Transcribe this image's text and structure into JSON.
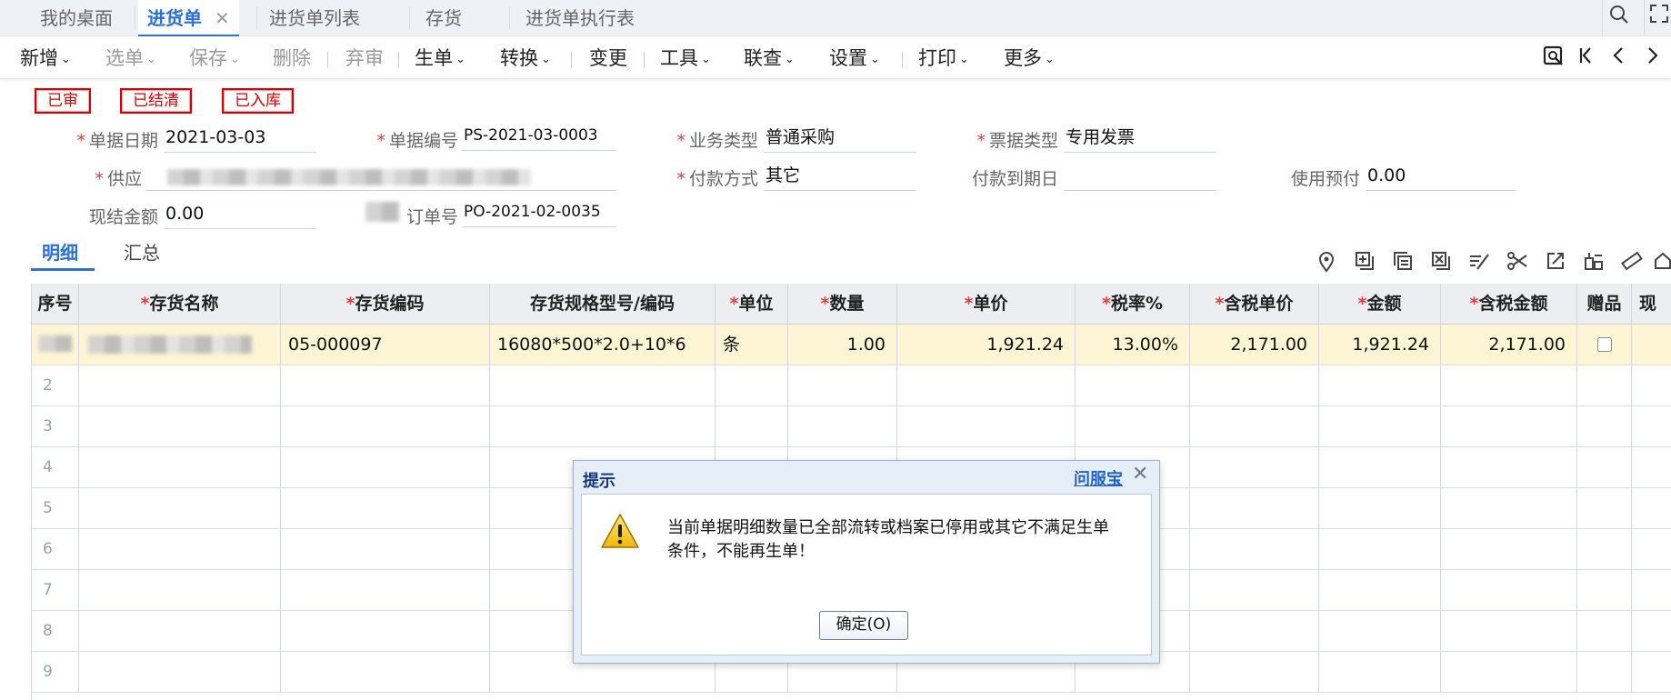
{
  "tabs": [
    {
      "label": "我的桌面"
    },
    {
      "label": "进货单",
      "close": "✕"
    },
    {
      "label": "进货单列表"
    },
    {
      "label": "存货"
    },
    {
      "label": "进货单执行表"
    }
  ],
  "toolbar": {
    "new": "新增",
    "select": "选单",
    "save": "保存",
    "delete": "删除",
    "unaudit": "弃审",
    "generate": "生单",
    "convert": "转换",
    "change": "变更",
    "tools": "工具",
    "query": "联查",
    "settings": "设置",
    "print": "打印",
    "more": "更多",
    "caret": "⌄"
  },
  "stamps": [
    "已审",
    "已结清",
    "已入库"
  ],
  "form": {
    "doc_date": {
      "label": "单据日期",
      "value": "2021-03-03"
    },
    "doc_no": {
      "label": "单据编号",
      "value": "PS-2021-03-0003"
    },
    "biz_type": {
      "label": "业务类型",
      "value": "普通采购"
    },
    "invoice_type": {
      "label": "票据类型",
      "value": "专用发票"
    },
    "supplier": {
      "label": "供应"
    },
    "pay_method": {
      "label": "付款方式",
      "value": "其它"
    },
    "pay_due": {
      "label": "付款到期日",
      "value": ""
    },
    "prepay": {
      "label": "使用预付",
      "value": "0.00"
    },
    "settle_amount": {
      "label": "现结金额",
      "value": "0.00"
    },
    "po_no": {
      "label": "订单号",
      "value": "PO-2021-02-0035"
    }
  },
  "subtabs": {
    "detail": "明细",
    "summary": "汇总"
  },
  "grid": {
    "headers": {
      "idx": "序号",
      "name": "存货名称",
      "code": "存货编码",
      "spec": "存货规格型号/编码",
      "unit": "单位",
      "qty": "数量",
      "price": "单价",
      "tax": "税率%",
      "tax_price": "含税单价",
      "amount": "金额",
      "tax_amount": "含税金额",
      "gift": "赠品",
      "extra": "现"
    },
    "req": "*",
    "row1": {
      "code": "05-000097",
      "spec": "16080*500*2.0+10*6",
      "unit": "条",
      "qty": "1.00",
      "price": "1,921.24",
      "tax": "13.00%",
      "tax_price": "2,171.00",
      "amount": "1,921.24",
      "tax_amount": "2,171.00"
    },
    "row_numbers": [
      "2",
      "3",
      "4",
      "5",
      "6",
      "7",
      "8",
      "9"
    ]
  },
  "dialog": {
    "title": "提示",
    "link": "问服宝",
    "close": "✕",
    "message": "当前单据明细数量已全部流转或档案已停用或其它不满足生单条件，不能再生单！",
    "ok": "确定(O)"
  },
  "colors": {
    "accent": "#2c6fd6",
    "stamp": "#d40000",
    "row_highlight": "#fdf5d3"
  }
}
